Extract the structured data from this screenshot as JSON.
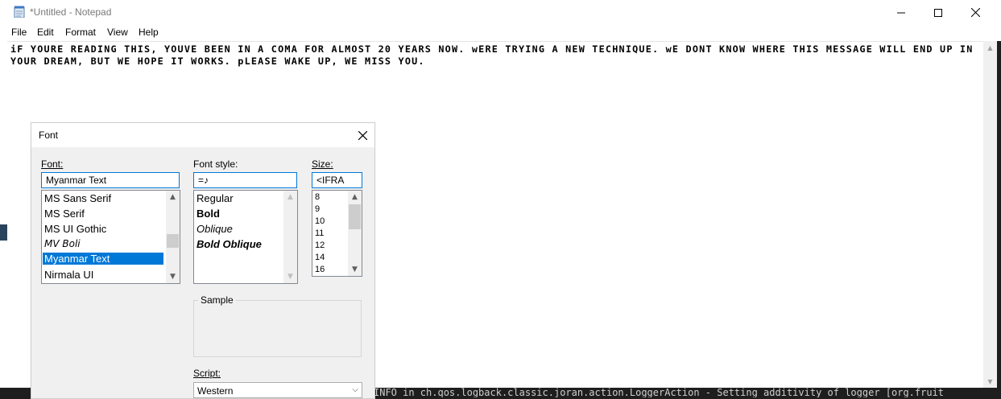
{
  "window": {
    "title": "*Untitled - Notepad",
    "controls": [
      "minimize",
      "maximize",
      "close"
    ]
  },
  "menu": [
    "File",
    "Edit",
    "Format",
    "View",
    "Help"
  ],
  "editor": {
    "text": "iF YOURE READING THIS, YOUVE BEEN IN A COMA FOR ALMOST 20 YEARS NOW. wERE TRYING A NEW TECHNIQUE. wE DONT KNOW WHERE THIS MESSAGE WILL END UP IN YOUR DREAM, BUT WE HOPE IT WORKS. pLEASE WAKE UP, WE MISS YOU."
  },
  "terminal": {
    "line": "INFO in ch.qos.logback.classic.joran.action.LoggerAction - Setting additivity of logger [org.fruit"
  },
  "font_dialog": {
    "title": "Font",
    "font_label": "Font:",
    "font_value": "Myanmar Text",
    "font_list": [
      "MS Sans Serif",
      "MS Serif",
      "MS UI Gothic",
      "MV Boli",
      "Myanmar Text",
      "Nirmala UI"
    ],
    "font_selected": "Myanmar Text",
    "style_label": "Font style:",
    "style_value": "=♪",
    "style_list": [
      "Regular",
      "Bold",
      "Oblique",
      "Bold Oblique"
    ],
    "size_label": "Size:",
    "size_value": "<IFRA",
    "size_list": [
      "8",
      "9",
      "10",
      "11",
      "12",
      "14",
      "16"
    ],
    "sample_label": "Sample",
    "script_label": "Script:",
    "script_value": "Western"
  },
  "colors": {
    "accent": "#0078d7",
    "dialog_bg": "#f0f0f0",
    "title_text": "#7a7a7a"
  }
}
